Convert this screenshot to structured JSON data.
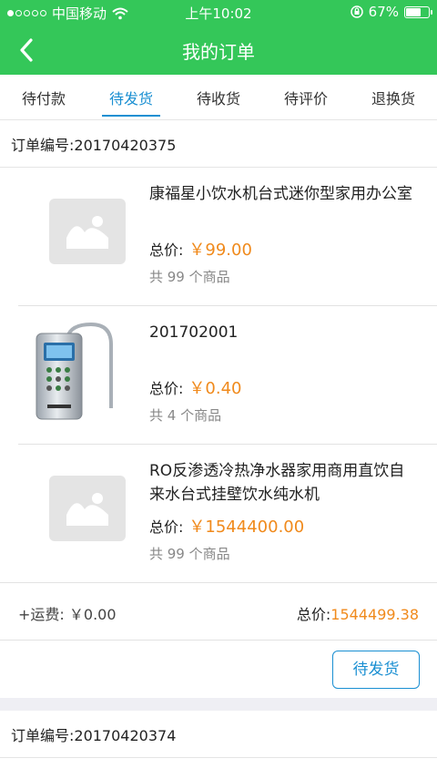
{
  "status_bar": {
    "carrier": "中国移动",
    "time": "上午10:02",
    "battery": "67%",
    "battery_level": 0.67
  },
  "nav": {
    "title": "我的订单"
  },
  "tabs": [
    {
      "label": "待付款",
      "active": false
    },
    {
      "label": "待发货",
      "active": true
    },
    {
      "label": "待收货",
      "active": false
    },
    {
      "label": "待评价",
      "active": false
    },
    {
      "label": "退换货",
      "active": false
    }
  ],
  "orders": [
    {
      "order_no_label": "订单编号:20170420375",
      "items": [
        {
          "name": "康福星小饮水机台式迷你型家用办公室",
          "price_label": "总价:",
          "price": "￥99.00",
          "count": "共 99 个商品",
          "image": "placeholder-image-icon"
        },
        {
          "name": "201702001",
          "price_label": "总价:",
          "price": "￥0.40",
          "count": "共 4 个商品",
          "image": "water-ionizer-product-icon"
        },
        {
          "name": "RO反渗透冷热净水器家用商用直饮自来水台式挂壁饮水纯水机",
          "price_label": "总价:",
          "price": "￥1544400.00",
          "count": "共 99 个商品",
          "image": "placeholder-image-icon"
        }
      ],
      "shipping": "+运费: ￥0.00",
      "total_label": "总价:",
      "total": "1544499.38",
      "status_button": "待发货"
    },
    {
      "order_no_label": "订单编号:20170420374"
    }
  ]
}
